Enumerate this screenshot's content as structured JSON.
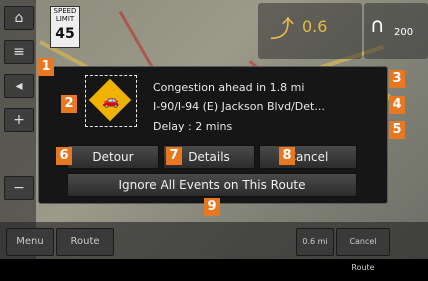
{
  "map": {
    "speed_limit": {
      "line1": "SPEED",
      "line2": "LIMIT",
      "value": "45"
    },
    "guidance": {
      "distance": "0.6",
      "next_distance": "200"
    },
    "sidebar": {
      "home_icon": "⌂",
      "menu_icon": "≡",
      "back_icon": "◂",
      "plus": "+",
      "minus": "−"
    },
    "bottom": {
      "menu": "Menu",
      "route": "Route",
      "dist": "0.6 mi",
      "cancel_route": "Cancel Route"
    }
  },
  "dialog": {
    "message_line1": "Congestion ahead in 1.8 mi",
    "message_line2": "I-90/I-94 (E) Jackson Blvd/Det...",
    "message_line3": "Delay : 2 mins",
    "detour_label": "Detour",
    "details_label": "Details",
    "cancel_label": "Cancel",
    "ignore_label": "Ignore All Events on This Route"
  },
  "callouts": [
    "1",
    "2",
    "3",
    "4",
    "5",
    "6",
    "7",
    "8",
    "9"
  ],
  "colors": {
    "callout": "#e87722",
    "warning": "#f0b400"
  }
}
